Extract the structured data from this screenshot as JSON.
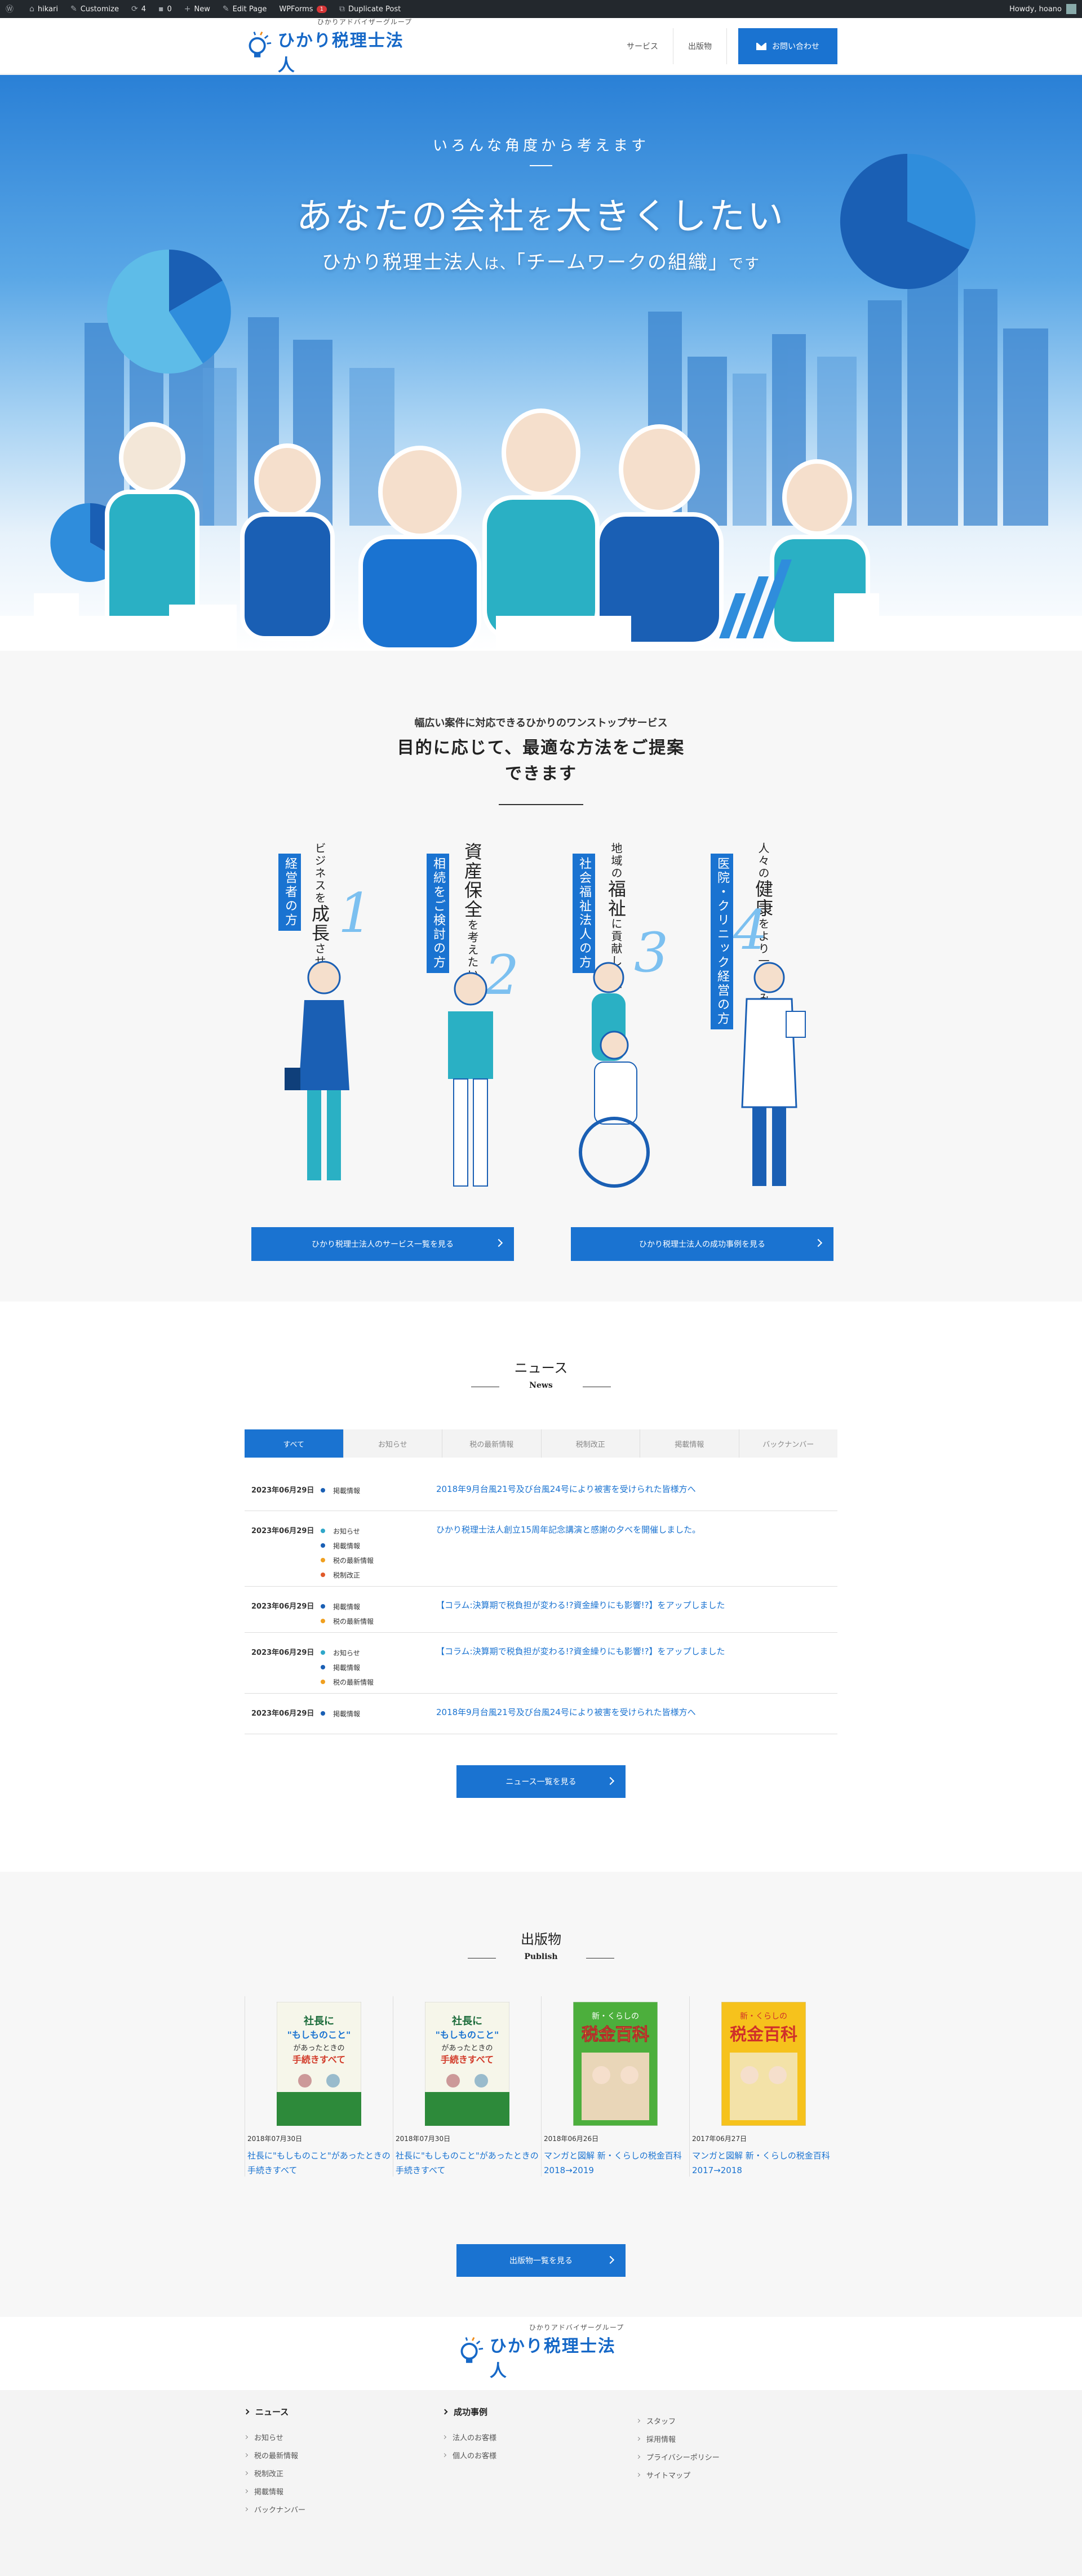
{
  "admin_bar": {
    "site": "hikari",
    "customize": "Customize",
    "updates": "4",
    "comments": "0",
    "new": "New",
    "edit_page": "Edit Page",
    "wpforms": "WPForms",
    "wpforms_badge": "1",
    "duplicate": "Duplicate Post",
    "howdy": "Howdy, hoano"
  },
  "header": {
    "logo_sub": "ひかりアドバイザーグループ",
    "logo_name": "ひかり税理士法人",
    "nav": [
      "サービス",
      "出版物"
    ],
    "contact": "お問い合わせ"
  },
  "hero": {
    "lead": "いろんな角度から考えます",
    "title_a": "あなたの会社",
    "title_b": "を",
    "title_c": "大きくしたい",
    "sub_a": "ひかり税理士法人",
    "sub_b": "は、",
    "sub_c": "「チームワークの組織」",
    "sub_d": "です"
  },
  "services": {
    "lead": "幅広い案件に対応できるひかりのワンストップサービス",
    "title_line1": "目的に応じて、最適な方法をご提案",
    "title_line2": "できます",
    "cards": [
      {
        "tag": "経営者の方",
        "text_small": "ビジネスを",
        "text_big": "成長",
        "text_end": "させたい",
        "num": "1"
      },
      {
        "tag": "相続をご検討の方",
        "text_small": "",
        "text_big": "資産保全",
        "text_end": "を考えたい",
        "num": "2"
      },
      {
        "tag": "社会福祉法人の方",
        "text_small": "地域の",
        "text_big": "福祉",
        "text_end": "に貢献したい",
        "num": "3"
      },
      {
        "tag": "医院・クリニック経営の方",
        "text_small": "人々の",
        "text_big": "健康",
        "text_end": "をより一層育みたい",
        "num": "4"
      }
    ],
    "btn_services": "ひかり税理士法人のサービス一覧を見る",
    "btn_cases": "ひかり税理士法人の成功事例を見る"
  },
  "news": {
    "title": "ニュース",
    "en": "News",
    "tabs": [
      "すべて",
      "お知らせ",
      "税の最新情報",
      "税制改正",
      "掲載情報",
      "バックナンバー"
    ],
    "rows": [
      {
        "date": "2023年06月29日",
        "cats": [
          "掲載情報"
        ],
        "title": "2018年9月台風21号及び台風24号により被害を受けられた皆様方へ"
      },
      {
        "date": "2023年06月29日",
        "cats": [
          "お知らせ",
          "掲載情報",
          "税の最新情報",
          "税制改正"
        ],
        "title": "ひかり税理士法人創立15周年記念講演と感謝の夕べを開催しました。"
      },
      {
        "date": "2023年06月29日",
        "cats": [
          "掲載情報",
          "税の最新情報"
        ],
        "title": "【コラム:決算期で税負担が変わる!?資金繰りにも影響!?】をアップしました"
      },
      {
        "date": "2023年06月29日",
        "cats": [
          "お知らせ",
          "掲載情報",
          "税の最新情報"
        ],
        "title": "【コラム:決算期で税負担が変わる!?資金繰りにも影響!?】をアップしました"
      },
      {
        "date": "2023年06月29日",
        "cats": [
          "掲載情報"
        ],
        "title": "2018年9月台風21号及び台風24号により被害を受けられた皆様方へ"
      }
    ],
    "more": "ニュース一覧を見る"
  },
  "cat_colors": {
    "お知らせ": "#2fa7c9",
    "掲載情報": "#1a5fb4",
    "税の最新情報": "#f0a020",
    "税制改正": "#e05a2a"
  },
  "publish": {
    "title": "出版物",
    "en": "Publish",
    "items": [
      {
        "date": "2018年07月30日",
        "title": "社長に\"もしものこと\"があったときの手続きすべて",
        "cover_a": "社長に",
        "cover_b": "\"もしものこと\"",
        "cover_c": "があったときの",
        "cover_d": "手続きすべて"
      },
      {
        "date": "2018年07月30日",
        "title": "社長に\"もしものこと\"があったときの手続きすべて",
        "cover_a": "社長に",
        "cover_b": "\"もしものこと\"",
        "cover_c": "があったときの",
        "cover_d": "手続きすべて"
      },
      {
        "date": "2018年06月26日",
        "title": "マンガと図解 新・くらしの税金百科 2018→2019",
        "cover_a": "新・くらしの",
        "cover_b": "税金百科",
        "cover_c": "",
        "cover_d": ""
      },
      {
        "date": "2017年06月27日",
        "title": "マンガと図解 新・くらしの税金百科 2017→2018",
        "cover_a": "新・くらしの",
        "cover_b": "税金百科",
        "cover_c": "",
        "cover_d": ""
      }
    ],
    "more": "出版物一覧を見る"
  },
  "footer": {
    "logo_sub": "ひかりアドバイザーグループ",
    "logo_name": "ひかり税理士法人",
    "col1_head": "ニュース",
    "col1": [
      "お知らせ",
      "税の最新情報",
      "税制改正",
      "掲載情報",
      "バックナンバー"
    ],
    "col2_head": "成功事例",
    "col2": [
      "法人のお客様",
      "個人のお客様"
    ],
    "col3": [
      "スタッフ",
      "採用情報",
      "プライバシーポリシー",
      "サイトマップ"
    ]
  }
}
